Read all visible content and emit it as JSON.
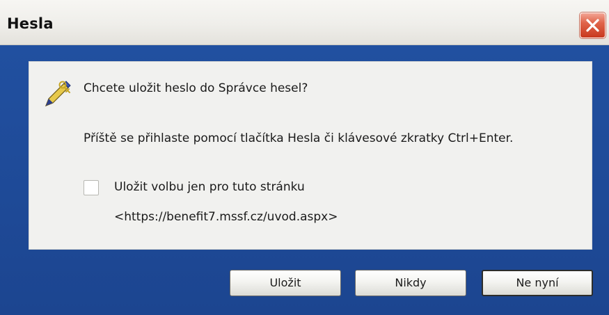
{
  "window": {
    "title": "Hesla"
  },
  "dialog": {
    "question": "Chcete uložit heslo do Správce hesel?",
    "hint": "Příště se přihlaste pomocí tlačítka Hesla či klávesové zkratky Ctrl+Enter.",
    "checkbox": {
      "label": "Uložit volbu jen pro tuto stránku",
      "checked": false
    },
    "url": "<https://benefit7.mssf.cz/uvod.aspx>",
    "icon": "pencil-key-icon"
  },
  "buttons": {
    "save_label": "Uložit",
    "never_label": "Nikdy",
    "not_now_label": "Ne nyní"
  },
  "colors": {
    "client_background": "#1f4a98",
    "panel_background": "#f1f1ef",
    "close_button": "#e0644a"
  }
}
